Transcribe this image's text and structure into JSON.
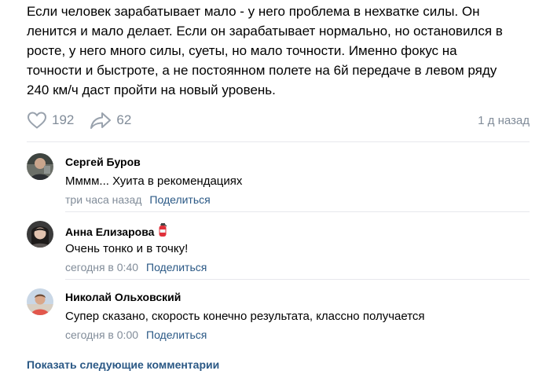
{
  "post": {
    "text": "Если человек зарабатывает мало - у него проблема в нехватке силы. Он\nленится и мало делает. Если он зарабатывает нормально, но остановился в\nросте, у него много силы, суеты, но мало точности. Именно фокус на\nточности и быстроте, а не постоянном полете на 6й передаче в левом ряду\n240 км/ч даст пройти на новый уровень.",
    "likes": "192",
    "shares": "62",
    "time_ago": "1 д назад"
  },
  "comments": [
    {
      "name": "Сергей Буров",
      "text": "Мммм... Хуита в рекомендациях",
      "time": "три часа назад",
      "share": "Поделиться"
    },
    {
      "name": "Анна Елизарова",
      "text": "Очень тонко и в точку!",
      "time": "сегодня в 0:40",
      "share": "Поделиться"
    },
    {
      "name": "Николай Ольховский",
      "text": "Супер сказано, скорость конечно результата, классно получается",
      "time": "сегодня в 0:00",
      "share": "Поделиться"
    }
  ],
  "show_more_label": "Показать следующие комментарии",
  "colors": {
    "link": "#2a5885",
    "muted": "#818c99",
    "separator": "#e7e8ec"
  },
  "icons": {
    "like": "heart-icon",
    "share": "share-arrow-icon",
    "badge": "fire-extinguisher-icon"
  }
}
